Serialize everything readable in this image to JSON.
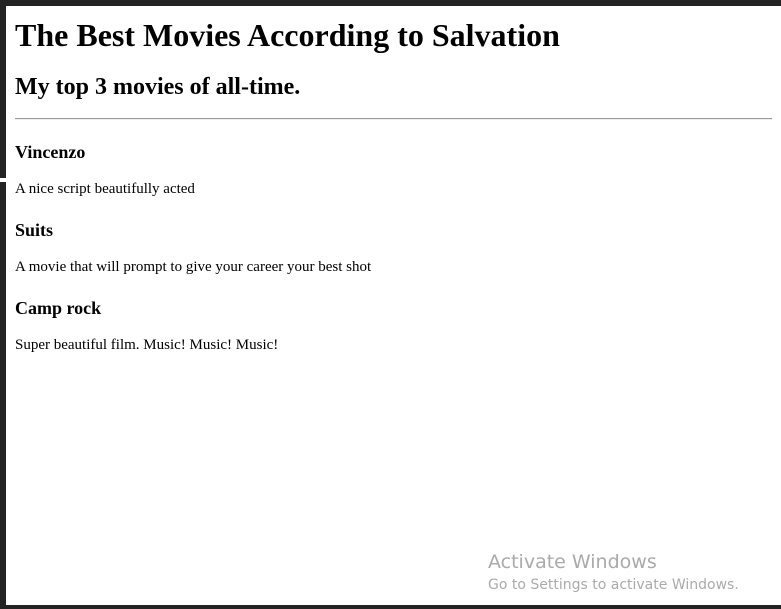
{
  "page": {
    "heading": "The Best Movies According to Salvation",
    "subheading": "My top 3 movies of all-time."
  },
  "movies": [
    {
      "title": "Vincenzo",
      "description": "A nice script beautifully acted"
    },
    {
      "title": "Suits",
      "description": "A movie that will prompt to give your career your best shot"
    },
    {
      "title": "Camp rock",
      "description": "Super beautiful film. Music! Music! Music!"
    }
  ],
  "watermark": {
    "title": "Activate Windows",
    "subtitle": "Go to Settings to activate Windows."
  },
  "colors": {
    "frame": "#232323",
    "page_background": "#ffffff",
    "text": "#000000",
    "divider": "#9a9a9a",
    "watermark_text": "#aaaaaa"
  }
}
